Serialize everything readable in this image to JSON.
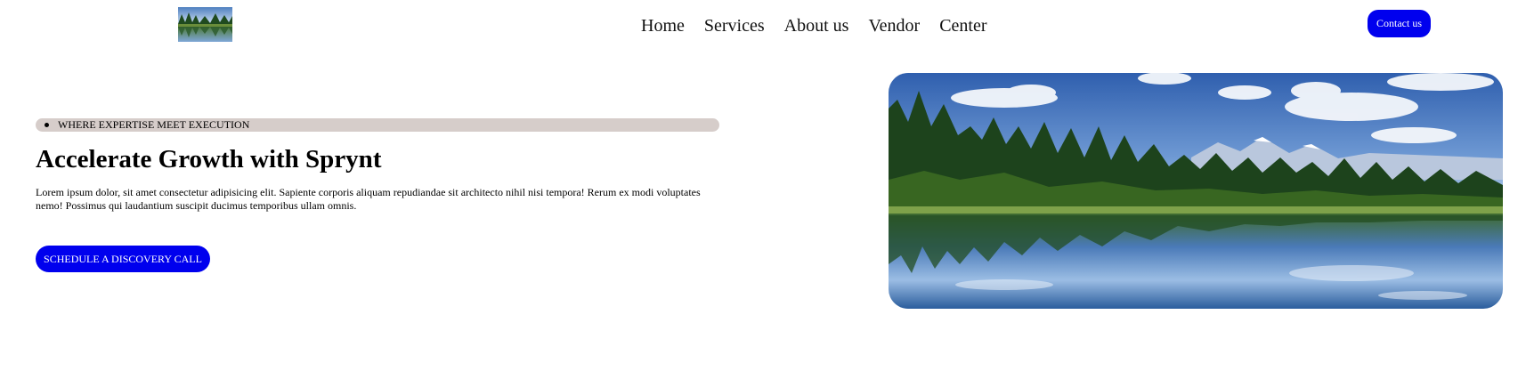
{
  "header": {
    "logo_icon": "landscape-lake-logo-icon",
    "nav": [
      {
        "label": "Home"
      },
      {
        "label": "Services"
      },
      {
        "label": "About us"
      },
      {
        "label": "Vendor"
      },
      {
        "label": "Center"
      }
    ],
    "contact_label": "Contact us"
  },
  "hero": {
    "tagline": "WHERE EXPERTISE MEET EXECUTION",
    "title": "Accelerate Growth with Sprynt",
    "body": "Lorem ipsum dolor, sit amet consectetur adipisicing elit. Sapiente corporis aliquam repudiandae sit architecto nihil nisi tempora! Rerum ex modi voluptates nemo! Possimus qui laudantium suscipit ducimus temporibus ullam omnis.",
    "cta_label": "SCHEDULE A DISCOVERY CALL",
    "image_icon": "forest-lake-landscape-image"
  },
  "colors": {
    "accent_blue": "#0000ee",
    "tagline_bg": "#d6cdca",
    "text": "#000000",
    "background": "#ffffff"
  }
}
